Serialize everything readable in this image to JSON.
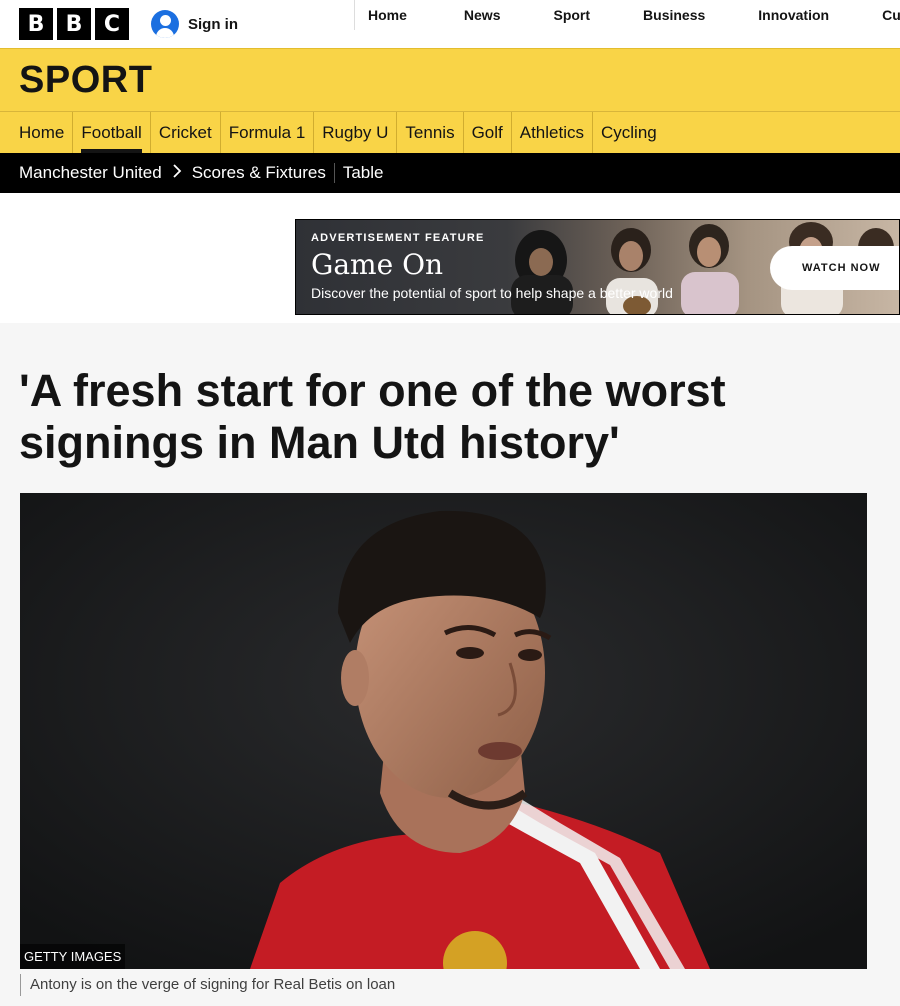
{
  "header": {
    "logo_letters": [
      "B",
      "B",
      "C"
    ],
    "signin_label": "Sign in",
    "nav": [
      "Home",
      "News",
      "Sport",
      "Business",
      "Innovation",
      "Cult"
    ]
  },
  "sport": {
    "title": "SPORT",
    "nav": [
      "Home",
      "Football",
      "Cricket",
      "Formula 1",
      "Rugby U",
      "Tennis",
      "Golf",
      "Athletics",
      "Cycling"
    ],
    "active": "Football"
  },
  "team_nav": {
    "team": "Manchester United",
    "links": [
      "Scores & Fixtures",
      "Table"
    ]
  },
  "ad": {
    "label": "ADVERTISEMENT FEATURE",
    "title": "Game On",
    "subtitle": "Discover the potential of sport to help shape a better world",
    "button": "WATCH NOW"
  },
  "article": {
    "headline": "'A fresh start for one of the worst signings in Man Utd history'",
    "image_credit": "GETTY IMAGES",
    "caption": "Antony is on the verge of signing for Real Betis on loan"
  },
  "colors": {
    "sport_yellow": "#f9d447",
    "signin_blue": "#1b6fe0",
    "team_nav_bg": "#000000"
  }
}
